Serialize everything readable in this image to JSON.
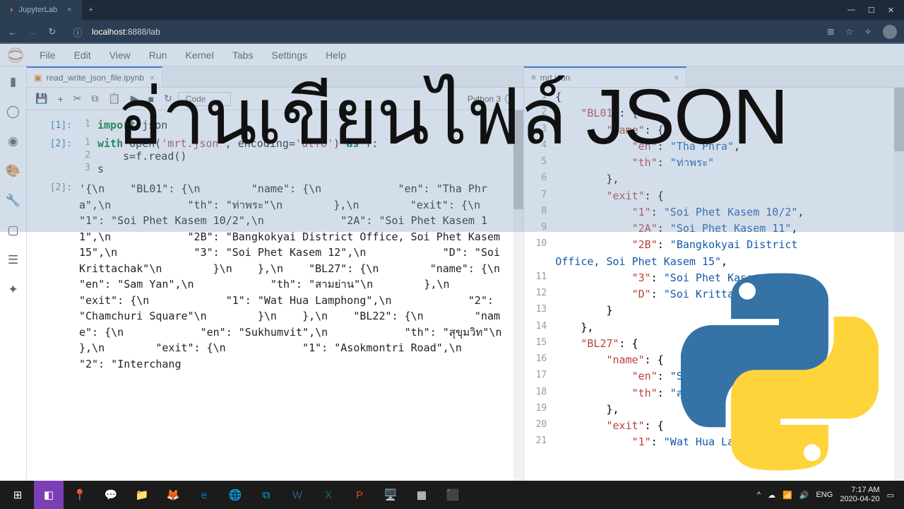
{
  "browser": {
    "tab_title": "JupyterLab",
    "url_host": "localhost",
    "url_path": ":8888/lab",
    "win_min": "—",
    "win_max": "☐",
    "win_close": "✕"
  },
  "menubar": [
    "File",
    "Edit",
    "View",
    "Run",
    "Kernel",
    "Tabs",
    "Settings",
    "Help"
  ],
  "toolbar": {
    "cell_type": "Code",
    "kernel": "Python 3"
  },
  "left_tab": {
    "filename": "read_write_json_file.ipynb"
  },
  "right_tab": {
    "filename": "mrt.json"
  },
  "cell1": {
    "prompt": "[1]:",
    "l1": " json"
  },
  "cell2": {
    "prompt": "[2]:",
    "l1a": "with",
    "l1b": " open(",
    "l1c": "'mrt.json'",
    "l1d": ", encoding=",
    "l1e": "'utf8'",
    "l1f": ") ",
    "l1g": "as",
    "l1h": " f:",
    "l2a": "    s=f.read()",
    "l3a": "s"
  },
  "out2": {
    "prompt": "[2]:",
    "text": "'{\\n    \"BL01\": {\\n        \"name\": {\\n            \"en\": \"Tha Phra\",\\n            \"th\": \"ท่าพระ\"\\n        },\\n        \"exit\": {\\n            \"1\": \"Soi Phet Kasem 10/2\",\\n            \"2A\": \"Soi Phet Kasem 11\",\\n            \"2B\": \"Bangkokyai District Office, Soi Phet Kasem 15\",\\n            \"3\": \"Soi Phet Kasem 12\",\\n            \"D\": \"Soi Krittachak\"\\n        }\\n    },\\n    \"BL27\": {\\n        \"name\": {\\n            \"en\": \"Sam Yan\",\\n            \"th\": \"สามย่าน\"\\n        },\\n        \"exit\": {\\n            \"1\": \"Wat Hua Lamphong\",\\n            \"2\": \"Chamchuri Square\"\\n        }\\n    },\\n    \"BL22\": {\\n        \"name\": {\\n            \"en\": \"Sukhumvit\",\\n            \"th\": \"สุขุมวิท\"\\n        },\\n        \"exit\": {\\n            \"1\": \"Asokmontri Road\",\\n            \"2\": \"Interchang"
  },
  "json_lines": [
    {
      "n": "1",
      "t": "{"
    },
    {
      "n": "2",
      "t": "    <k>\"BL01\"</k>: {"
    },
    {
      "n": "3",
      "t": "        <k>\"name\"</k>: {"
    },
    {
      "n": "4",
      "t": "            <k>\"en\"</k>: <v>\"Tha Phra\"</v>,"
    },
    {
      "n": "5",
      "t": "            <k>\"th\"</k>: <v>\"ท่าพระ\"</v>"
    },
    {
      "n": "6",
      "t": "        },"
    },
    {
      "n": "7",
      "t": "        <k>\"exit\"</k>: {"
    },
    {
      "n": "8",
      "t": "            <k>\"1\"</k>: <v>\"Soi Phet Kasem 10/2\"</v>,"
    },
    {
      "n": "9",
      "t": "            <k>\"2A\"</k>: <v>\"Soi Phet Kasem 11\"</v>,"
    },
    {
      "n": "10",
      "t": "            <k>\"2B\"</k>: <v>\"Bangkokyai District </v>"
    },
    {
      "n": "",
      "t": "<v>Office, Soi Phet Kasem 15\"</v>,"
    },
    {
      "n": "11",
      "t": "            <k>\"3\"</k>: <v>\"Soi Phet Kasem 12\"</v>,"
    },
    {
      "n": "12",
      "t": "            <k>\"D\"</k>: <v>\"Soi Krittachak\"</v>"
    },
    {
      "n": "13",
      "t": "        }"
    },
    {
      "n": "14",
      "t": "    },"
    },
    {
      "n": "15",
      "t": "    <k>\"BL27\"</k>: {"
    },
    {
      "n": "16",
      "t": "        <k>\"name\"</k>: {"
    },
    {
      "n": "17",
      "t": "            <k>\"en\"</k>: <v>\"Sam Yan\"</v>,"
    },
    {
      "n": "18",
      "t": "            <k>\"th\"</k>: <v>\"สามย่าน\"</v>"
    },
    {
      "n": "19",
      "t": "        },"
    },
    {
      "n": "20",
      "t": "        <k>\"exit\"</k>: {"
    },
    {
      "n": "21",
      "t": "            <k>\"1\"</k>: <v>\"Wat Hua Lamphong\"</v>,"
    }
  ],
  "overlay_title": "อ่านเขียนไฟล์ JSON",
  "taskbar_right": {
    "lang": "ENG",
    "time": "7:17 AM",
    "date": "2020-04-20"
  }
}
